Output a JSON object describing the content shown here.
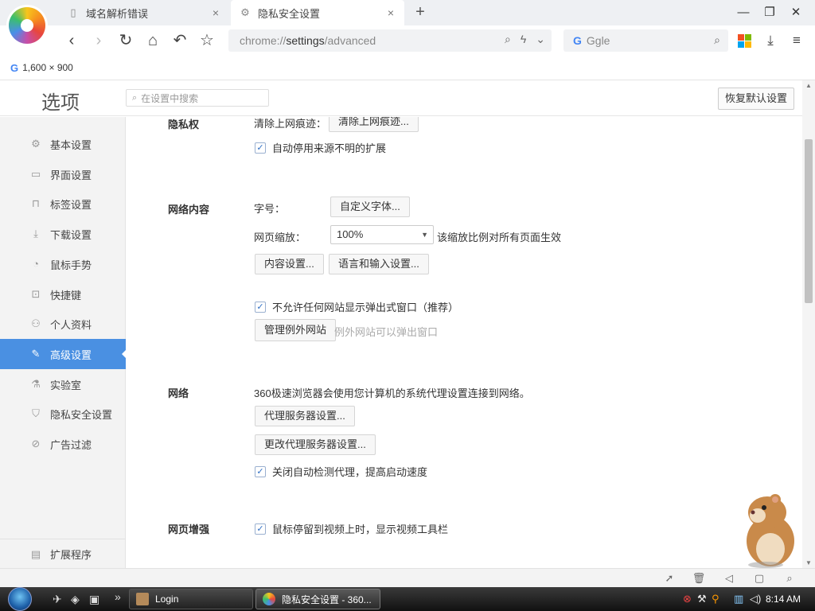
{
  "browser": {
    "tabs": [
      {
        "label": "域名解析错误",
        "close": "×"
      },
      {
        "label": "隐私安全设置",
        "close": "×"
      }
    ],
    "new_tab": "+",
    "window": {
      "minimize": "—",
      "restore": "❐",
      "close": "✕"
    },
    "url": {
      "scheme": "chrome://",
      "host": "settings",
      "path": "/advanced"
    },
    "search": {
      "engine_letter": "G",
      "placeholder": "Ggle"
    },
    "bookmark": {
      "engine_letter": "G",
      "label": "1,600 × 900"
    }
  },
  "settings": {
    "title": "选项",
    "search_placeholder": "在设置中搜索",
    "reset_button": "恢复默认设置",
    "sidebar": [
      {
        "label": "基本设置",
        "icon": "gear-icon"
      },
      {
        "label": "界面设置",
        "icon": "window-icon"
      },
      {
        "label": "标签设置",
        "icon": "tab-icon"
      },
      {
        "label": "下载设置",
        "icon": "download-icon"
      },
      {
        "label": "鼠标手势",
        "icon": "mouse-icon"
      },
      {
        "label": "快捷键",
        "icon": "keyboard-icon"
      },
      {
        "label": "个人资料",
        "icon": "user-icon"
      },
      {
        "label": "高级设置",
        "icon": "wrench-icon",
        "active": true
      },
      {
        "label": "实验室",
        "icon": "lab-icon"
      },
      {
        "label": "隐私安全设置",
        "icon": "shield-icon"
      },
      {
        "label": "广告过滤",
        "icon": "block-icon"
      }
    ],
    "sidebar_bottom": {
      "label": "扩展程序",
      "icon": "extension-icon"
    },
    "privacy": {
      "title": "隐私权",
      "clear_label": "清除上网痕迹：",
      "clear_button": "清除上网痕迹...",
      "disable_unknown_ext": "自动停用来源不明的扩展"
    },
    "web_content": {
      "title": "网络内容",
      "font_label": "字号：",
      "font_button": "自定义字体...",
      "zoom_label": "网页缩放：",
      "zoom_value": "100%",
      "zoom_hint": "该缩放比例对所有页面生效",
      "content_button": "内容设置...",
      "language_button": "语言和输入设置...",
      "block_popups": "不允许任何网站显示弹出式窗口（推荐）",
      "exceptions_button": "管理例外网站",
      "exceptions_hint": "例外网站可以弹出窗口"
    },
    "network": {
      "title": "网络",
      "description": "360极速浏览器会使用您计算机的系统代理设置连接到网络。",
      "proxy_button": "代理服务器设置...",
      "change_proxy_button": "更改代理服务器设置...",
      "disable_auto_detect": "关闭自动检测代理，提高启动速度"
    },
    "enhance": {
      "title": "网页增强",
      "video_toolbar": "鼠标停留到视频上时，显示视频工具栏"
    }
  },
  "taskbar": {
    "items": [
      {
        "label": "Login"
      },
      {
        "label": "隐私安全设置 - 360..."
      }
    ],
    "quick_more": "»",
    "clock": "8:14 AM"
  },
  "colors": {
    "accent": "#4a90e2",
    "check": "#2c6dc4"
  }
}
